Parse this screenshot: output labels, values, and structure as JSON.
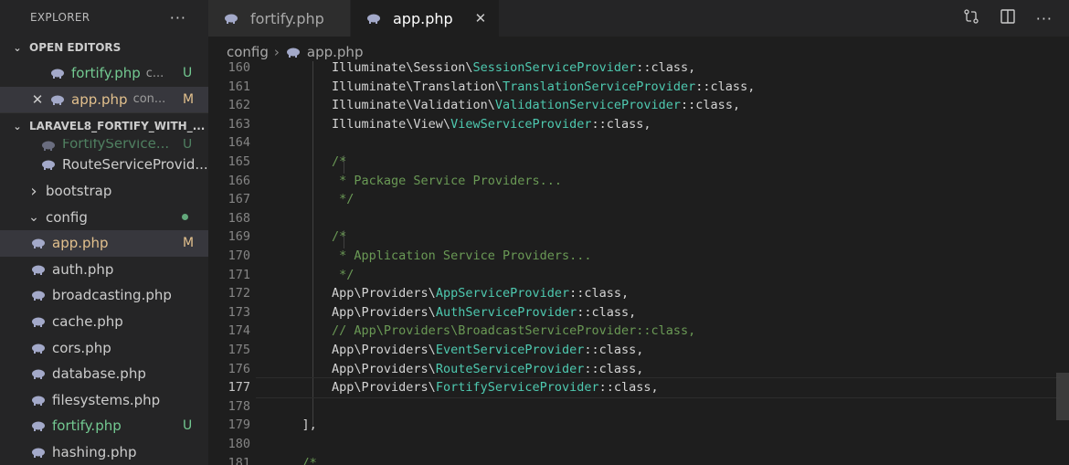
{
  "explorer": {
    "title": "EXPLORER",
    "more_label": "···",
    "open_editors": {
      "header": "OPEN EDITORS",
      "items": [
        {
          "name": "fortify.php",
          "desc": "c...",
          "badge": "U"
        },
        {
          "name": "app.php",
          "desc": "con...",
          "badge": "M"
        }
      ]
    },
    "project": {
      "header": "LARAVEL8_FORTIFY_WITH_...",
      "items": [
        {
          "name": "FortifyService...",
          "badge": "U",
          "kind": "file",
          "partial": true
        },
        {
          "name": "RouteServiceProvid...",
          "kind": "file"
        },
        {
          "name": "bootstrap",
          "kind": "folder-collapsed"
        },
        {
          "name": "config",
          "kind": "folder-open"
        },
        {
          "name": "app.php",
          "badge": "M",
          "kind": "file",
          "selected": true
        },
        {
          "name": "auth.php",
          "kind": "file"
        },
        {
          "name": "broadcasting.php",
          "kind": "file"
        },
        {
          "name": "cache.php",
          "kind": "file"
        },
        {
          "name": "cors.php",
          "kind": "file"
        },
        {
          "name": "database.php",
          "kind": "file"
        },
        {
          "name": "filesystems.php",
          "kind": "file"
        },
        {
          "name": "fortify.php",
          "badge": "U",
          "kind": "file"
        },
        {
          "name": "hashing.php",
          "kind": "file"
        }
      ]
    }
  },
  "tabs": [
    {
      "name": "fortify.php",
      "active": false
    },
    {
      "name": "app.php",
      "active": true,
      "close": "✕"
    }
  ],
  "breadcrumb": {
    "folder": "config",
    "file": "app.php"
  },
  "icons": {
    "php": "php-elephant-icon",
    "compare": "compare-changes-icon",
    "split": "split-editor-icon",
    "more": "more-actions-icon"
  },
  "colors": {
    "modified": "#e2c08d",
    "untracked": "#73c991",
    "class_name": "#4ec9b0",
    "comment": "#6a9955"
  },
  "code": {
    "current_line": "177",
    "lines": [
      {
        "n": "160",
        "parts": [
          {
            "t": "        Illuminate\\Session\\",
            "c": "ns"
          },
          {
            "t": "SessionServiceProvider",
            "c": "cls"
          },
          {
            "t": "::class,",
            "c": "ns"
          }
        ]
      },
      {
        "n": "161",
        "parts": [
          {
            "t": "        Illuminate\\Translation\\",
            "c": "ns"
          },
          {
            "t": "TranslationServiceProvider",
            "c": "cls"
          },
          {
            "t": "::class,",
            "c": "ns"
          }
        ]
      },
      {
        "n": "162",
        "parts": [
          {
            "t": "        Illuminate\\Validation\\",
            "c": "ns"
          },
          {
            "t": "ValidationServiceProvider",
            "c": "cls"
          },
          {
            "t": "::class,",
            "c": "ns"
          }
        ]
      },
      {
        "n": "163",
        "parts": [
          {
            "t": "        Illuminate\\View\\",
            "c": "ns"
          },
          {
            "t": "ViewServiceProvider",
            "c": "cls"
          },
          {
            "t": "::class,",
            "c": "ns"
          }
        ]
      },
      {
        "n": "164",
        "parts": []
      },
      {
        "n": "165",
        "parts": [
          {
            "t": "        /*",
            "c": "cmt"
          }
        ]
      },
      {
        "n": "166",
        "parts": [
          {
            "t": "         * Package Service Providers...",
            "c": "cmt"
          }
        ]
      },
      {
        "n": "167",
        "parts": [
          {
            "t": "         */",
            "c": "cmt"
          }
        ]
      },
      {
        "n": "168",
        "parts": []
      },
      {
        "n": "169",
        "parts": [
          {
            "t": "        /*",
            "c": "cmt"
          }
        ]
      },
      {
        "n": "170",
        "parts": [
          {
            "t": "         * Application Service Providers...",
            "c": "cmt"
          }
        ]
      },
      {
        "n": "171",
        "parts": [
          {
            "t": "         */",
            "c": "cmt"
          }
        ]
      },
      {
        "n": "172",
        "parts": [
          {
            "t": "        App\\Providers\\",
            "c": "ns"
          },
          {
            "t": "AppServiceProvider",
            "c": "cls"
          },
          {
            "t": "::class,",
            "c": "ns"
          }
        ]
      },
      {
        "n": "173",
        "parts": [
          {
            "t": "        App\\Providers\\",
            "c": "ns"
          },
          {
            "t": "AuthServiceProvider",
            "c": "cls"
          },
          {
            "t": "::class,",
            "c": "ns"
          }
        ]
      },
      {
        "n": "174",
        "parts": [
          {
            "t": "        // App\\Providers\\BroadcastServiceProvider::class,",
            "c": "cmt"
          }
        ]
      },
      {
        "n": "175",
        "parts": [
          {
            "t": "        App\\Providers\\",
            "c": "ns"
          },
          {
            "t": "EventServiceProvider",
            "c": "cls"
          },
          {
            "t": "::class,",
            "c": "ns"
          }
        ]
      },
      {
        "n": "176",
        "parts": [
          {
            "t": "        App\\Providers\\",
            "c": "ns"
          },
          {
            "t": "RouteServiceProvider",
            "c": "cls"
          },
          {
            "t": "::class,",
            "c": "ns"
          }
        ]
      },
      {
        "n": "177",
        "parts": [
          {
            "t": "        App\\Providers\\",
            "c": "ns"
          },
          {
            "t": "FortifyServiceProvider",
            "c": "cls"
          },
          {
            "t": "::class,",
            "c": "ns"
          }
        ]
      },
      {
        "n": "178",
        "parts": []
      },
      {
        "n": "179",
        "parts": [
          {
            "t": "    ],",
            "c": "ns"
          }
        ]
      },
      {
        "n": "180",
        "parts": []
      },
      {
        "n": "181",
        "parts": [
          {
            "t": "    /*",
            "c": "cmt"
          }
        ]
      }
    ]
  }
}
